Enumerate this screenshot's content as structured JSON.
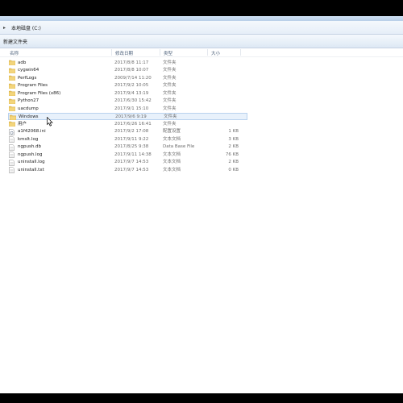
{
  "address": {
    "arrow": "▸",
    "path": "本地磁盘 (C:)"
  },
  "toolbar": {
    "new_folder_label": "新建文件夹"
  },
  "columns": {
    "name": "名称",
    "date": "修改日期",
    "type": "类型",
    "size": "大小"
  },
  "files": [
    {
      "name": "adb",
      "date": "2017/8/8 11:17",
      "type": "文件夹",
      "size": "",
      "kind": "folder"
    },
    {
      "name": "cygwin64",
      "date": "2017/8/8 10:07",
      "type": "文件夹",
      "size": "",
      "kind": "folder"
    },
    {
      "name": "PerfLogs",
      "date": "2009/7/14 11:20",
      "type": "文件夹",
      "size": "",
      "kind": "folder"
    },
    {
      "name": "Program Files",
      "date": "2017/9/2 10:05",
      "type": "文件夹",
      "size": "",
      "kind": "folder"
    },
    {
      "name": "Program Files (x86)",
      "date": "2017/9/4 13:19",
      "type": "文件夹",
      "size": "",
      "kind": "folder"
    },
    {
      "name": "Python27",
      "date": "2017/6/30 15:42",
      "type": "文件夹",
      "size": "",
      "kind": "folder"
    },
    {
      "name": "uacdump",
      "date": "2017/9/1 15:10",
      "type": "文件夹",
      "size": "",
      "kind": "folder"
    },
    {
      "name": "Windows",
      "date": "2017/9/6 9:19",
      "type": "文件夹",
      "size": "",
      "kind": "folder",
      "hover": true
    },
    {
      "name": "用户",
      "date": "2017/6/26 16:41",
      "type": "文件夹",
      "size": "",
      "kind": "folder"
    },
    {
      "name": "a1f42068.ini",
      "date": "2017/9/2 17:08",
      "type": "配置设置",
      "size": "1 KB",
      "kind": "ini"
    },
    {
      "name": "kmsIt.log",
      "date": "2017/9/11 9:22",
      "type": "文本文档",
      "size": "3 KB",
      "kind": "file"
    },
    {
      "name": "ngpush.db",
      "date": "2017/8/25 9:38",
      "type": "Data Base File",
      "size": "2 KB",
      "kind": "file"
    },
    {
      "name": "ngpush.log",
      "date": "2017/9/11 14:38",
      "type": "文本文档",
      "size": "76 KB",
      "kind": "file"
    },
    {
      "name": "uninstall.log",
      "date": "2017/9/7 14:53",
      "type": "文本文档",
      "size": "2 KB",
      "kind": "file"
    },
    {
      "name": "uninstall.txt",
      "date": "2017/9/7 14:53",
      "type": "文本文档",
      "size": "0 KB",
      "kind": "file"
    }
  ],
  "colors": {
    "folder": "#e8c25a",
    "hover_bg": "#e8f1fb",
    "hover_border": "#b9d2ee",
    "header_text": "#4c607a"
  }
}
